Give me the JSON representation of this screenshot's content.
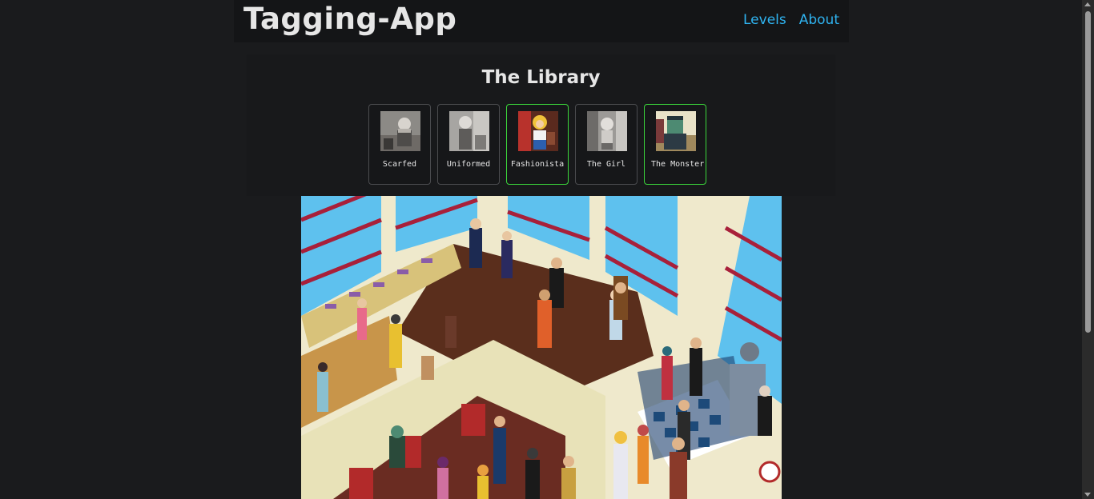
{
  "header": {
    "brand": "Tagging-App",
    "nav": [
      {
        "label": "Levels"
      },
      {
        "label": "About"
      }
    ]
  },
  "level": {
    "title": "The Library",
    "characters": [
      {
        "name": "Scarfed",
        "found": false
      },
      {
        "name": "Uniformed",
        "found": false
      },
      {
        "name": "Fashionista",
        "found": true
      },
      {
        "name": "The Girl",
        "found": false
      },
      {
        "name": "The Monster",
        "found": true
      }
    ]
  },
  "colors": {
    "accent_link": "#2fb3f0",
    "found_border": "#3bd63b",
    "background": "#1a1b1d"
  }
}
